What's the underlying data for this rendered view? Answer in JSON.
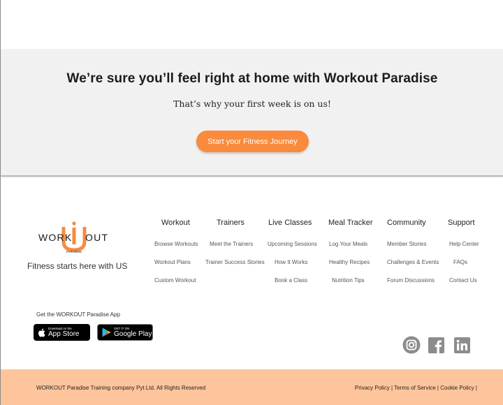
{
  "cta": {
    "title": "We’re sure you’ll feel right at home with Workout Paradise",
    "subtitle": "That’s why your first week is on us!",
    "button_label": "Start your Fitness Journey"
  },
  "brand": {
    "logo_text_left": "WORK",
    "logo_text_right": "OUT",
    "logo_subtext": "PARADISE",
    "tagline": "Fitness starts here with US",
    "accent_color": "#fa8a3c"
  },
  "columns": [
    {
      "heading": "Workout",
      "links": [
        "Browse Workouts",
        "Workout Plans",
        "Custom Workout"
      ]
    },
    {
      "heading": "Trainers",
      "links": [
        "Meet the Trainers",
        "Trainer Success Stories"
      ]
    },
    {
      "heading": "Live Classes",
      "links": [
        "Upcoming Sessions",
        "How It Works",
        "Book a Class"
      ]
    },
    {
      "heading": "Meal Tracker",
      "links": [
        "Log Your Meals",
        "Healthy Recipes",
        "Nutrition Tips"
      ]
    },
    {
      "heading": "Community",
      "links": [
        "Member Stories",
        "Challenges & Events",
        "Forum Discussions"
      ]
    },
    {
      "heading": "Support",
      "links": [
        "Help Center",
        "FAQs",
        "Contact Us"
      ]
    }
  ],
  "app": {
    "label": "Get the WORKOUT Paradise App",
    "app_store_small": "Download on the",
    "app_store_big": "App Store",
    "google_play_small": "GET IT ON",
    "google_play_big": "Google Play"
  },
  "social": [
    "instagram-icon",
    "facebook-icon",
    "linkedin-icon"
  ],
  "footer": {
    "copyright": "WORKOUT Paradise Training company Pyt Ltd. All Rights Reserved",
    "privacy": "Privacy Policy",
    "terms": "Terms of Service",
    "cookie": "Cookie Policy",
    "bar_color": "#fec59d"
  }
}
